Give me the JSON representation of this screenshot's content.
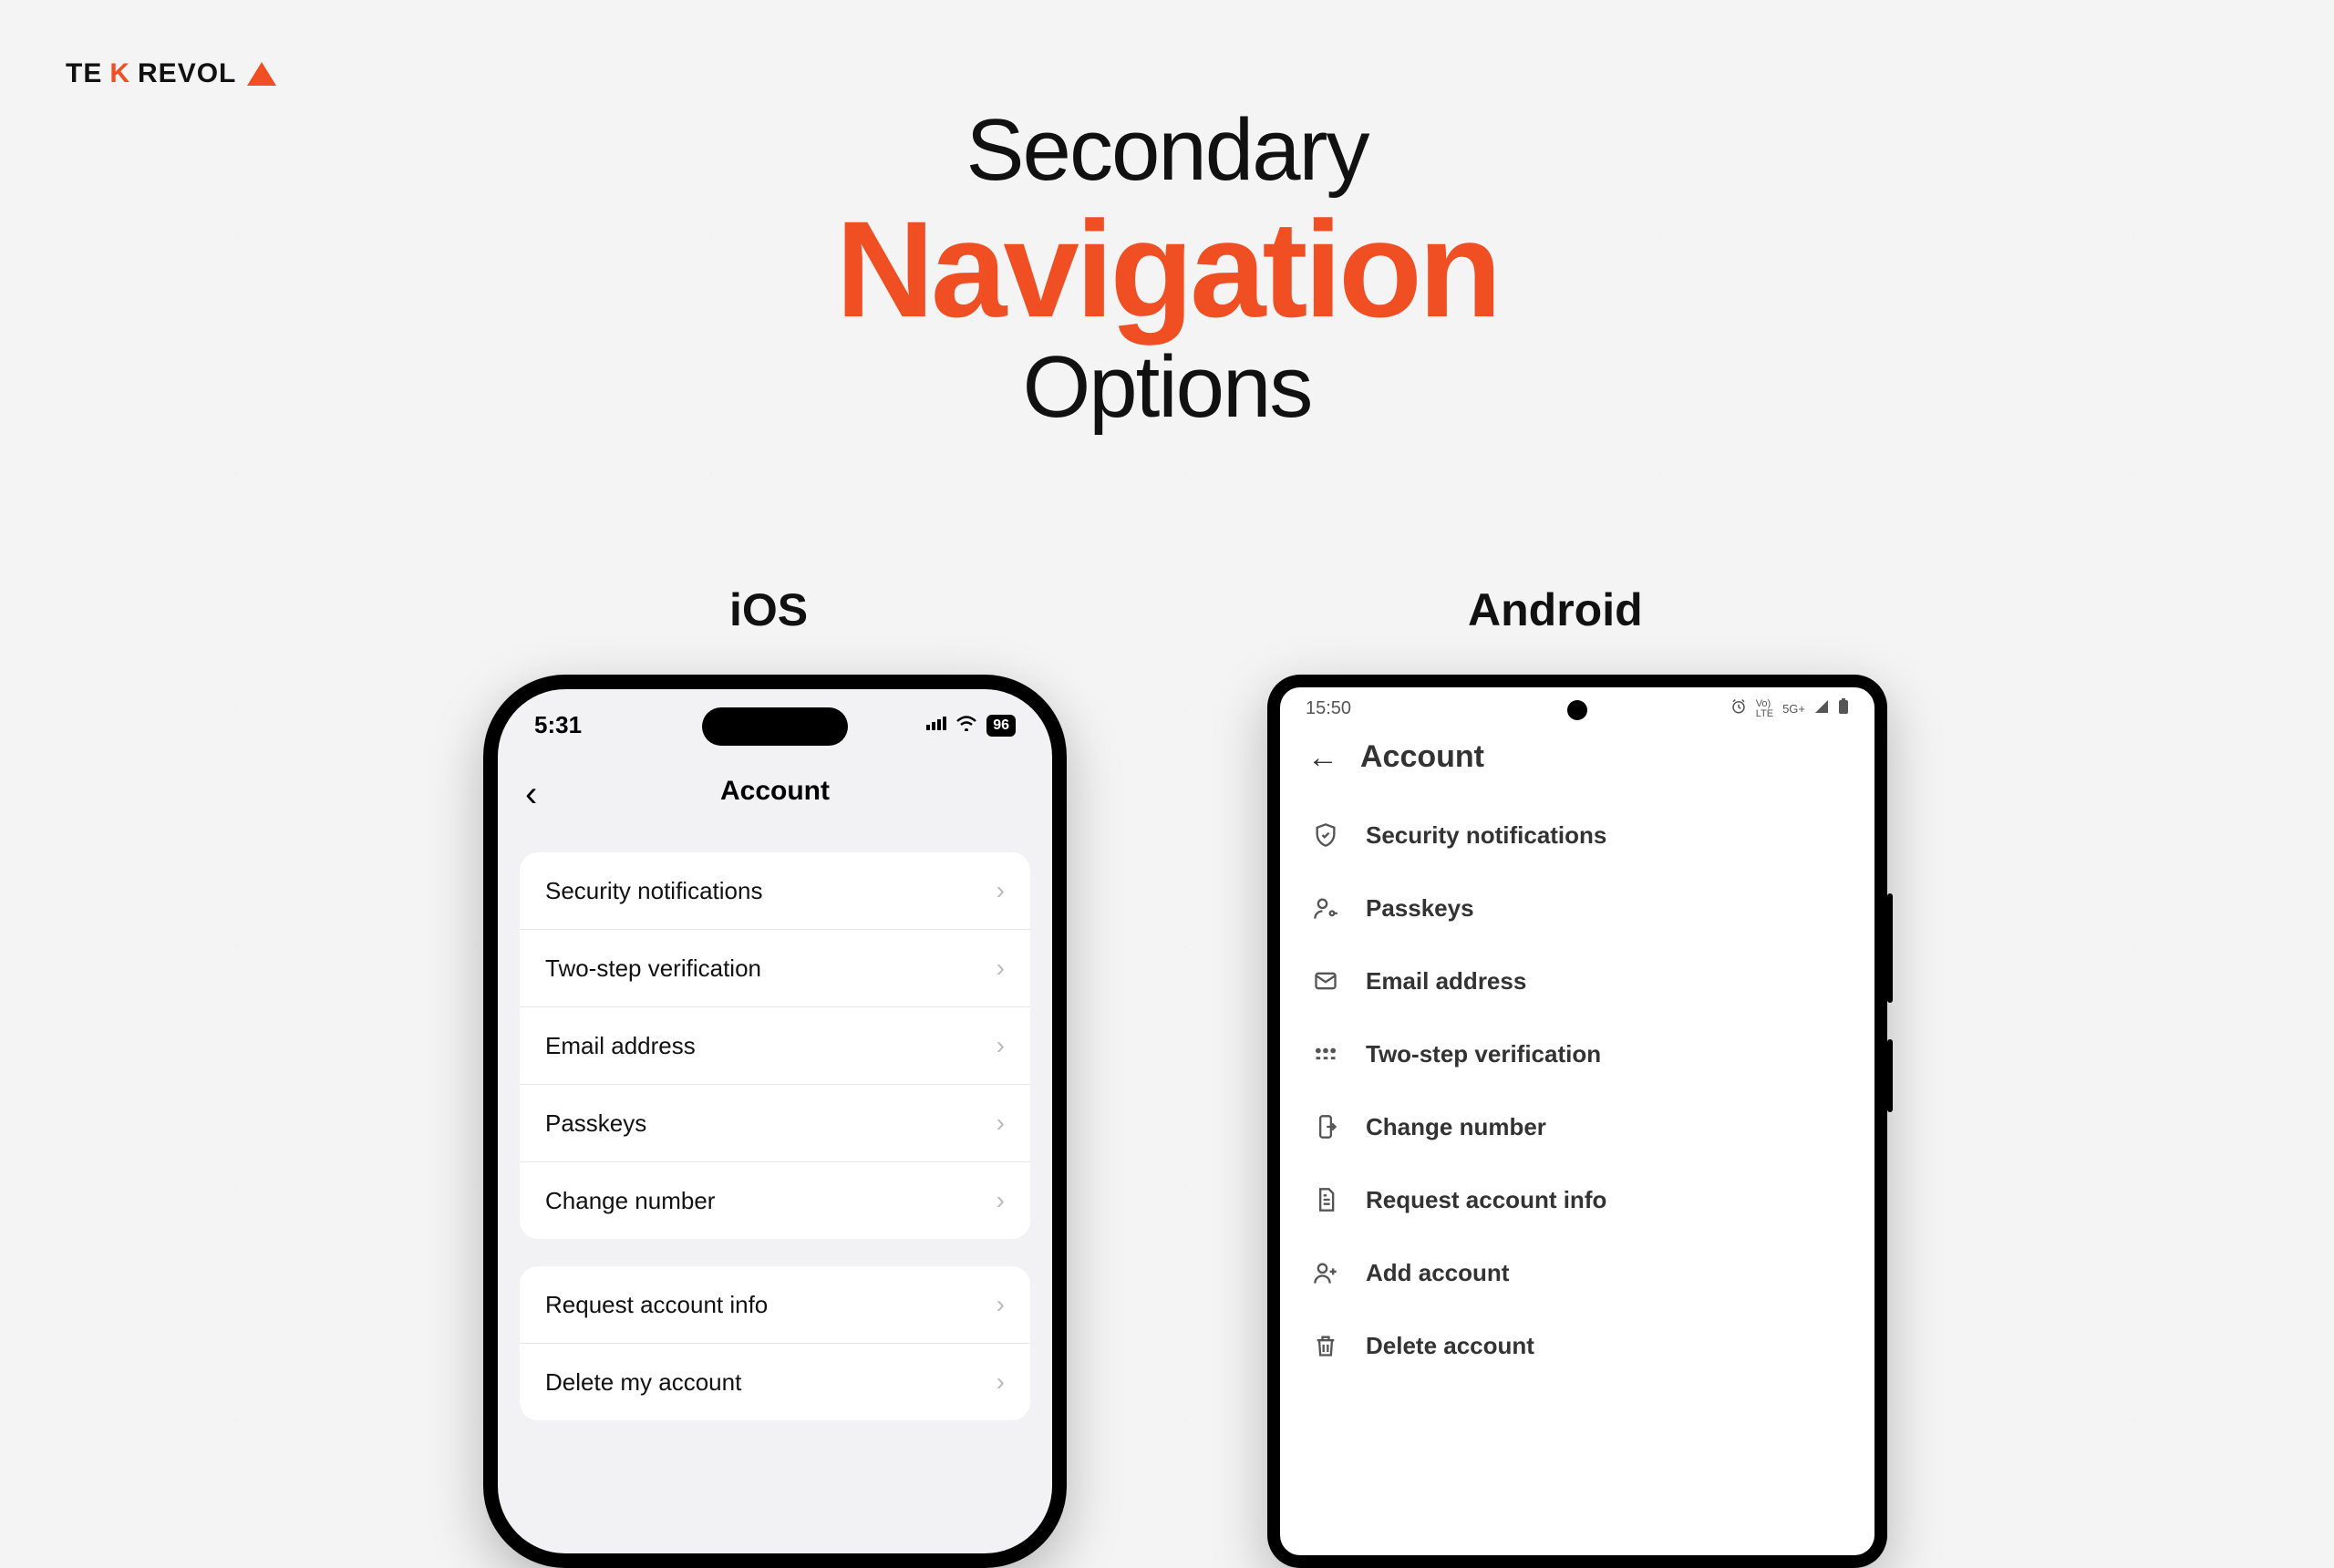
{
  "logo": {
    "brand_pre": "TE",
    "brand_mark": "K",
    "brand_post": "REVOL"
  },
  "title": {
    "line1": "Secondary",
    "line2": "Navigation",
    "line3": "Options"
  },
  "columns": {
    "ios_label": "iOS",
    "android_label": "Android"
  },
  "ios": {
    "status": {
      "time": "5:31",
      "battery": "96"
    },
    "header": {
      "title": "Account"
    },
    "groups": [
      {
        "items": [
          {
            "label": "Security notifications"
          },
          {
            "label": "Two-step verification"
          },
          {
            "label": "Email address"
          },
          {
            "label": "Passkeys"
          },
          {
            "label": "Change number"
          }
        ]
      },
      {
        "items": [
          {
            "label": "Request account info"
          },
          {
            "label": "Delete my account"
          }
        ]
      }
    ]
  },
  "android": {
    "status": {
      "time": "15:50",
      "net": "5G+"
    },
    "header": {
      "title": "Account"
    },
    "items": [
      {
        "label": "Security notifications",
        "icon": "shield"
      },
      {
        "label": "Passkeys",
        "icon": "personkey"
      },
      {
        "label": "Email address",
        "icon": "mail"
      },
      {
        "label": "Two-step verification",
        "icon": "pin"
      },
      {
        "label": "Change number",
        "icon": "phonemove"
      },
      {
        "label": "Request account info",
        "icon": "doc"
      },
      {
        "label": "Add account",
        "icon": "personadd"
      },
      {
        "label": "Delete account",
        "icon": "trash"
      }
    ]
  }
}
